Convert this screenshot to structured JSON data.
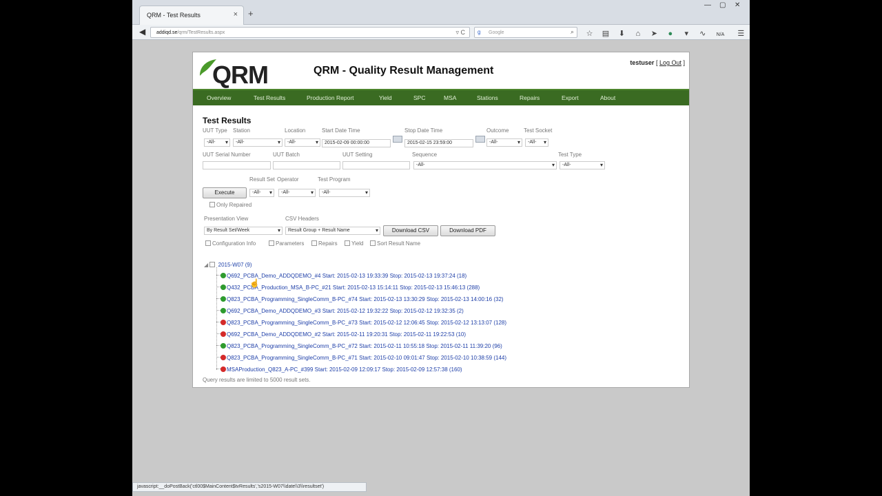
{
  "browser": {
    "tab_title": "QRM - Test Results",
    "tab_close": "×",
    "new_tab": "+",
    "url_host": "addiqd.se",
    "url_path": "/qrm/TestResults.aspx",
    "url_tools": "▿ C",
    "search_engine": "g",
    "search_placeholder": "Google",
    "search_go": "⌕",
    "toolbar_text": "N/A",
    "status_text": "javascript:__doPostBack('ctl00$MainContent$tvResults','s2015-W07\\\\date\\\\3\\\\resultset')"
  },
  "header": {
    "logo_text": "QRM",
    "title": "QRM - Quality Result Management",
    "user": "testuser",
    "logout": "Log Out"
  },
  "menu": [
    {
      "label": "Overview"
    },
    {
      "label": "Test Results"
    },
    {
      "label": "Production Report"
    },
    {
      "label": "Yield"
    },
    {
      "label": "SPC"
    },
    {
      "label": "MSA"
    },
    {
      "label": "Stations"
    },
    {
      "label": "Repairs"
    },
    {
      "label": "Export"
    },
    {
      "label": "About"
    }
  ],
  "filters": {
    "section_title": "Test Results",
    "uut_type_label": "UUT Type",
    "station_label": "Station",
    "location_label": "Location",
    "start_label": "Start Date Time",
    "stop_label": "Stop Date Time",
    "outcome_label": "Outcome",
    "socket_label": "Test Socket",
    "all": "-All-",
    "start_value": "2015-02-09 00:00:00",
    "stop_value": "2015-02-15 23:59:00",
    "serial_label": "UUT Serial Number",
    "batch_label": "UUT Batch",
    "setting_label": "UUT Setting",
    "sequence_label": "Sequence",
    "test_type_label": "Test Type",
    "result_set_label": "Result Set",
    "operator_label": "Operator",
    "program_label": "Test Program",
    "execute": "Execute",
    "only_repaired": "Only Repaired",
    "presentation_label": "Presentation View",
    "presentation_value": "By Result Set/Week",
    "csv_label": "CSV Headers",
    "csv_value": "Result Group + Result Name",
    "download_csv": "Download CSV",
    "download_pdf": "Download PDF",
    "opt_config": "Configuration Info",
    "opt_params": "Parameters",
    "opt_repairs": "Repairs",
    "opt_yield": "Yield",
    "opt_sort": "Sort Result Name"
  },
  "tree": {
    "root": "2015-W07 (9)",
    "items": [
      {
        "status": "pass",
        "text": "Q692_PCBA_Demo_ADDQDEMO_#4 Start: 2015-02-13 19:33:39 Stop: 2015-02-13 19:37:24 (18)"
      },
      {
        "status": "pass",
        "text": "Q432_PCBA_Production_MSA_B-PC_#21 Start: 2015-02-13 15:14:11 Stop: 2015-02-13 15:46:13 (288)"
      },
      {
        "status": "pass",
        "text": "Q823_PCBA_Programming_SingleComm_B-PC_#74 Start: 2015-02-13 13:30:29 Stop: 2015-02-13 14:00:16 (32)"
      },
      {
        "status": "pass",
        "text": "Q692_PCBA_Demo_ADDQDEMO_#3 Start: 2015-02-12 19:32:22 Stop: 2015-02-12 19:32:35 (2)"
      },
      {
        "status": "fail",
        "text": "Q823_PCBA_Programming_SingleComm_B-PC_#73 Start: 2015-02-12 12:06:45 Stop: 2015-02-12 13:13:07 (128)"
      },
      {
        "status": "fail",
        "text": "Q692_PCBA_Demo_ADDQDEMO_#2 Start: 2015-02-11 19:20:31 Stop: 2015-02-11 19:22:53 (10)"
      },
      {
        "status": "pass",
        "text": "Q823_PCBA_Programming_SingleComm_B-PC_#72 Start: 2015-02-11 10:55:18 Stop: 2015-02-11 11:39:20 (96)"
      },
      {
        "status": "fail",
        "text": "Q823_PCBA_Programming_SingleComm_B-PC_#71 Start: 2015-02-10 09:01:47 Stop: 2015-02-10 10:38:59 (144)"
      },
      {
        "status": "fail",
        "text": "MSAProduction_Q823_A-PC_#399 Start: 2015-02-09 12:09:17 Stop: 2015-02-09 12:57:38 (160)"
      }
    ]
  },
  "footer_note": "Query results are limited to 5000 result sets.",
  "colors": {
    "menu_bg": "#3a6b22",
    "link": "#1e3fa8",
    "pass": "#2e9b2e",
    "fail": "#d42a2a"
  }
}
